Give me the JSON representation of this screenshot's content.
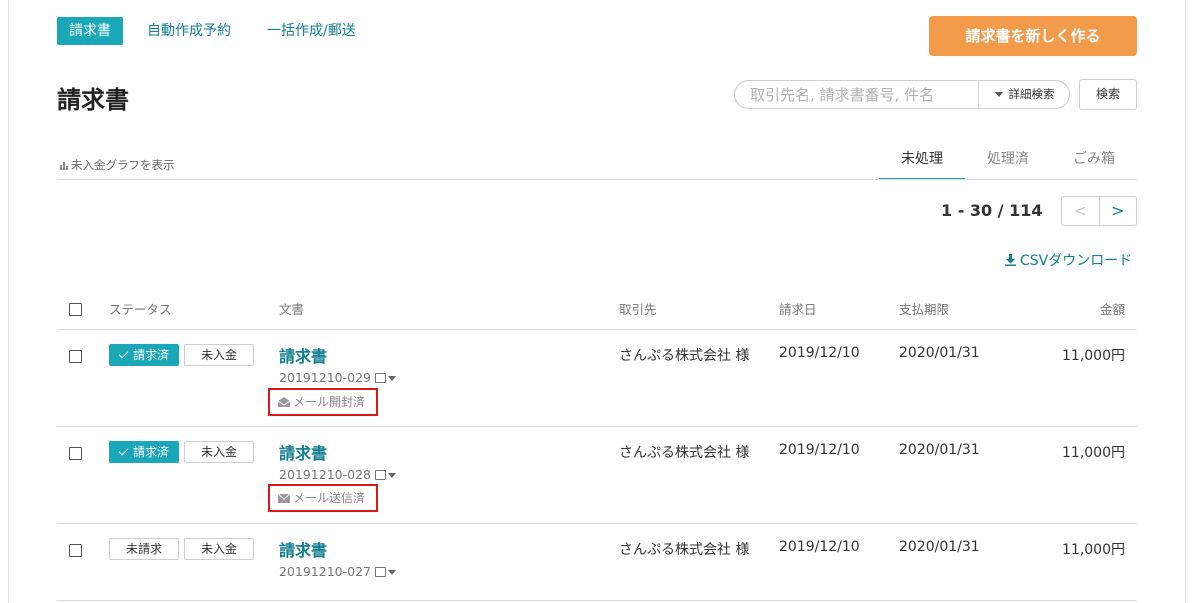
{
  "subnav": {
    "active": "請求書",
    "links": [
      "自動作成予約",
      "一括作成/郵送"
    ]
  },
  "new_button": "請求書を新しく作る",
  "page_title": "請求書",
  "search": {
    "placeholder": "取引先名, 請求書番号, 件名",
    "advanced_label": "詳細検索",
    "button_label": "検索"
  },
  "graph_link": "未入金グラフを表示",
  "tabs": [
    {
      "label": "未処理",
      "active": true
    },
    {
      "label": "処理済",
      "active": false
    },
    {
      "label": "ごみ箱",
      "active": false
    }
  ],
  "pagination": {
    "range": "1 - 30 / 114",
    "prev": "<",
    "next": ">"
  },
  "csv_download": "CSVダウンロード",
  "table": {
    "headers": {
      "status": "ステータス",
      "document": "文書",
      "client": "取引先",
      "invoice_date": "請求日",
      "due_date": "支払期限",
      "amount": "金額"
    },
    "rows": [
      {
        "billing_status": "請求済",
        "billed": true,
        "payment_status": "未入金",
        "doc_title": "請求書",
        "doc_number": "20191210-029",
        "mail_status": "メール開封済",
        "mail_icon": "envelope-open-icon",
        "client": "さんぷる株式会社 様",
        "invoice_date": "2019/12/10",
        "due_date": "2020/01/31",
        "amount": "11,000円"
      },
      {
        "billing_status": "請求済",
        "billed": true,
        "payment_status": "未入金",
        "doc_title": "請求書",
        "doc_number": "20191210-028",
        "mail_status": "メール送信済",
        "mail_icon": "envelope-icon",
        "client": "さんぷる株式会社 様",
        "invoice_date": "2019/12/10",
        "due_date": "2020/01/31",
        "amount": "11,000円"
      },
      {
        "billing_status": "未請求",
        "billed": false,
        "payment_status": "未入金",
        "doc_title": "請求書",
        "doc_number": "20191210-027",
        "mail_status": "",
        "client": "さんぷる株式会社 様",
        "invoice_date": "2019/12/10",
        "due_date": "2020/01/31",
        "amount": "11,000円"
      }
    ]
  },
  "colors": {
    "accent": "#1aa7b8",
    "link": "#127f93",
    "primary_button": "#f29b4b",
    "highlight_border": "#d81919"
  }
}
